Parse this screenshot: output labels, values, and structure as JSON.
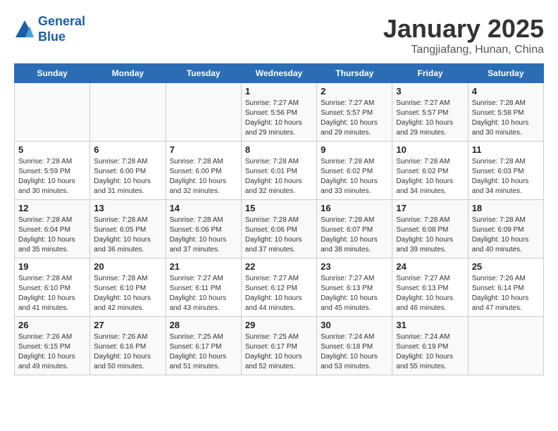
{
  "header": {
    "logo_line1": "General",
    "logo_line2": "Blue",
    "month": "January 2025",
    "location": "Tangjiafang, Hunan, China"
  },
  "days_of_week": [
    "Sunday",
    "Monday",
    "Tuesday",
    "Wednesday",
    "Thursday",
    "Friday",
    "Saturday"
  ],
  "weeks": [
    [
      {
        "day": "",
        "info": ""
      },
      {
        "day": "",
        "info": ""
      },
      {
        "day": "",
        "info": ""
      },
      {
        "day": "1",
        "info": "Sunrise: 7:27 AM\nSunset: 5:56 PM\nDaylight: 10 hours and 29 minutes."
      },
      {
        "day": "2",
        "info": "Sunrise: 7:27 AM\nSunset: 5:57 PM\nDaylight: 10 hours and 29 minutes."
      },
      {
        "day": "3",
        "info": "Sunrise: 7:27 AM\nSunset: 5:57 PM\nDaylight: 10 hours and 29 minutes."
      },
      {
        "day": "4",
        "info": "Sunrise: 7:28 AM\nSunset: 5:58 PM\nDaylight: 10 hours and 30 minutes."
      }
    ],
    [
      {
        "day": "5",
        "info": "Sunrise: 7:28 AM\nSunset: 5:59 PM\nDaylight: 10 hours and 30 minutes."
      },
      {
        "day": "6",
        "info": "Sunrise: 7:28 AM\nSunset: 6:00 PM\nDaylight: 10 hours and 31 minutes."
      },
      {
        "day": "7",
        "info": "Sunrise: 7:28 AM\nSunset: 6:00 PM\nDaylight: 10 hours and 32 minutes."
      },
      {
        "day": "8",
        "info": "Sunrise: 7:28 AM\nSunset: 6:01 PM\nDaylight: 10 hours and 32 minutes."
      },
      {
        "day": "9",
        "info": "Sunrise: 7:28 AM\nSunset: 6:02 PM\nDaylight: 10 hours and 33 minutes."
      },
      {
        "day": "10",
        "info": "Sunrise: 7:28 AM\nSunset: 6:02 PM\nDaylight: 10 hours and 34 minutes."
      },
      {
        "day": "11",
        "info": "Sunrise: 7:28 AM\nSunset: 6:03 PM\nDaylight: 10 hours and 34 minutes."
      }
    ],
    [
      {
        "day": "12",
        "info": "Sunrise: 7:28 AM\nSunset: 6:04 PM\nDaylight: 10 hours and 35 minutes."
      },
      {
        "day": "13",
        "info": "Sunrise: 7:28 AM\nSunset: 6:05 PM\nDaylight: 10 hours and 36 minutes."
      },
      {
        "day": "14",
        "info": "Sunrise: 7:28 AM\nSunset: 6:06 PM\nDaylight: 10 hours and 37 minutes."
      },
      {
        "day": "15",
        "info": "Sunrise: 7:28 AM\nSunset: 6:06 PM\nDaylight: 10 hours and 37 minutes."
      },
      {
        "day": "16",
        "info": "Sunrise: 7:28 AM\nSunset: 6:07 PM\nDaylight: 10 hours and 38 minutes."
      },
      {
        "day": "17",
        "info": "Sunrise: 7:28 AM\nSunset: 6:08 PM\nDaylight: 10 hours and 39 minutes."
      },
      {
        "day": "18",
        "info": "Sunrise: 7:28 AM\nSunset: 6:09 PM\nDaylight: 10 hours and 40 minutes."
      }
    ],
    [
      {
        "day": "19",
        "info": "Sunrise: 7:28 AM\nSunset: 6:10 PM\nDaylight: 10 hours and 41 minutes."
      },
      {
        "day": "20",
        "info": "Sunrise: 7:28 AM\nSunset: 6:10 PM\nDaylight: 10 hours and 42 minutes."
      },
      {
        "day": "21",
        "info": "Sunrise: 7:27 AM\nSunset: 6:11 PM\nDaylight: 10 hours and 43 minutes."
      },
      {
        "day": "22",
        "info": "Sunrise: 7:27 AM\nSunset: 6:12 PM\nDaylight: 10 hours and 44 minutes."
      },
      {
        "day": "23",
        "info": "Sunrise: 7:27 AM\nSunset: 6:13 PM\nDaylight: 10 hours and 45 minutes."
      },
      {
        "day": "24",
        "info": "Sunrise: 7:27 AM\nSunset: 6:13 PM\nDaylight: 10 hours and 46 minutes."
      },
      {
        "day": "25",
        "info": "Sunrise: 7:26 AM\nSunset: 6:14 PM\nDaylight: 10 hours and 47 minutes."
      }
    ],
    [
      {
        "day": "26",
        "info": "Sunrise: 7:26 AM\nSunset: 6:15 PM\nDaylight: 10 hours and 49 minutes."
      },
      {
        "day": "27",
        "info": "Sunrise: 7:26 AM\nSunset: 6:16 PM\nDaylight: 10 hours and 50 minutes."
      },
      {
        "day": "28",
        "info": "Sunrise: 7:25 AM\nSunset: 6:17 PM\nDaylight: 10 hours and 51 minutes."
      },
      {
        "day": "29",
        "info": "Sunrise: 7:25 AM\nSunset: 6:17 PM\nDaylight: 10 hours and 52 minutes."
      },
      {
        "day": "30",
        "info": "Sunrise: 7:24 AM\nSunset: 6:18 PM\nDaylight: 10 hours and 53 minutes."
      },
      {
        "day": "31",
        "info": "Sunrise: 7:24 AM\nSunset: 6:19 PM\nDaylight: 10 hours and 55 minutes."
      },
      {
        "day": "",
        "info": ""
      }
    ]
  ]
}
